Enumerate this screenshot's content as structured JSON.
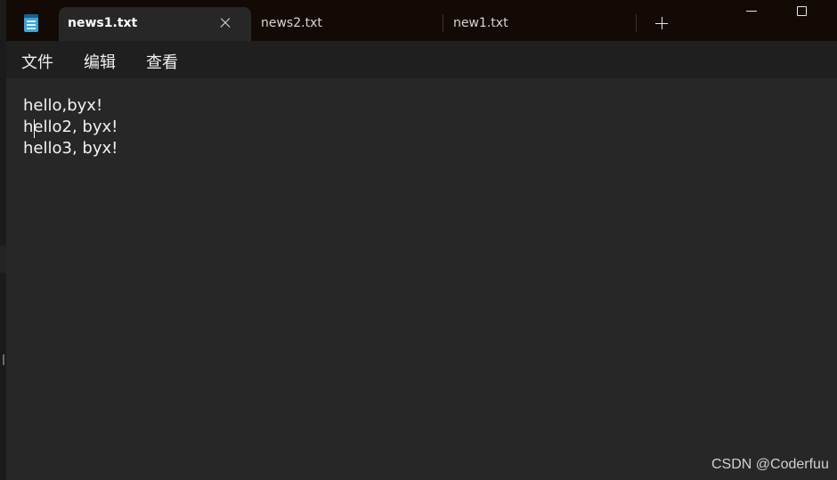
{
  "tabs": [
    {
      "label": "news1.txt",
      "active": true
    },
    {
      "label": "news2.txt",
      "active": false
    },
    {
      "label": "new1.txt",
      "active": false
    }
  ],
  "icons": {
    "app": "notepad-icon",
    "tab_close": "close-icon",
    "new_tab": "plus-icon",
    "minimize": "minimize-icon",
    "maximize": "maximize-icon"
  },
  "menu": {
    "file": "文件",
    "edit": "编辑",
    "view": "查看"
  },
  "editor": {
    "lines": [
      "hello,byx!",
      "hello2, byx!",
      "hello3, byx!"
    ]
  },
  "watermark": "CSDN @Coderfuu",
  "colors": {
    "titlebar": "#130a05",
    "menubar": "#1f1f1f",
    "editor_bg": "#272727",
    "text": "#f2f2f2",
    "app_icon": "#3aa6dc"
  }
}
